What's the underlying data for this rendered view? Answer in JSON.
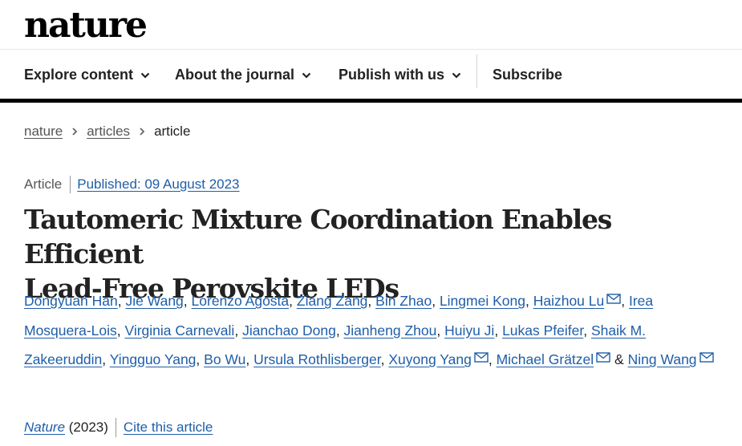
{
  "header": {
    "logo_text": "nature"
  },
  "nav": {
    "items": [
      {
        "label": "Explore content",
        "has_dropdown": true
      },
      {
        "label": "About the journal",
        "has_dropdown": true
      },
      {
        "label": "Publish with us",
        "has_dropdown": true
      },
      {
        "label": "Subscribe",
        "has_dropdown": false
      }
    ]
  },
  "breadcrumb": {
    "items": [
      "nature",
      "articles",
      "article"
    ]
  },
  "article": {
    "type": "Article",
    "published": "Published: 09 August 2023",
    "title_line1": "Tautomeric Mixture Coordination Enables Efficient",
    "title_line2": "Lead-Free Perovskite LEDs",
    "authors": [
      "Dongyuan Han",
      "Jie Wang",
      "Lorenzo Agosta",
      "Ziang Zang",
      "Bin Zhao",
      "Lingmei Kong",
      "Haizhou Lu",
      "Irea Mosquera-Lois",
      "Virginia Carnevali",
      "Jianchao Dong",
      "Jianheng Zhou",
      "Huiyu Ji",
      "Lukas Pfeifer",
      "Shaik M. Zakeeruddin",
      "Yingguo Yang",
      "Bo Wu",
      "Ursula Rothlisberger",
      "Xuyong Yang",
      "Michael Grätzel",
      "Ning Wang"
    ],
    "ampersand": "&",
    "journal": "Nature",
    "year": "(2023)",
    "cite_label": "Cite this article"
  },
  "colors": {
    "link": "#1f5ea8",
    "text": "#222222",
    "muted": "#555555",
    "rule": "#000000"
  },
  "icons": {
    "dropdown": "chevron-down-icon",
    "breadcrumb_sep": "chevron-right-icon",
    "email": "mail-icon"
  }
}
